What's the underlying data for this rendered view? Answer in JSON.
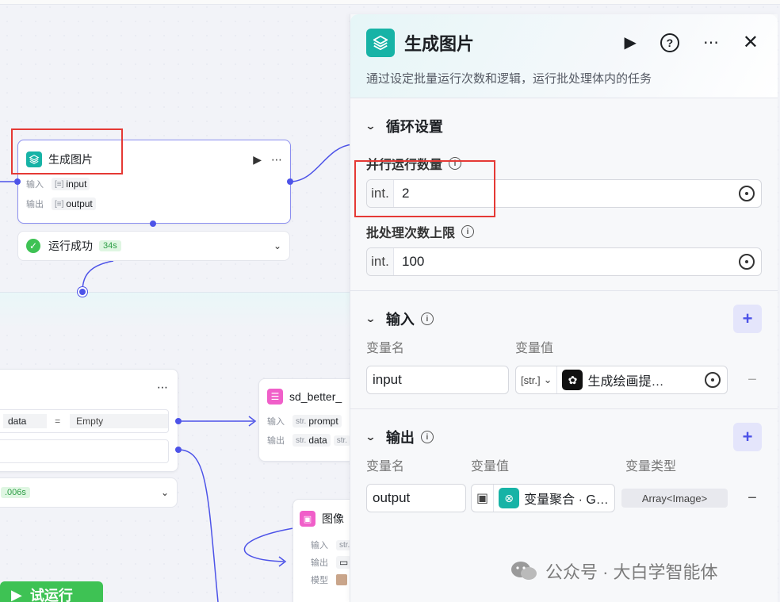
{
  "canvas": {
    "node_main": {
      "title": "生成图片",
      "input_label": "输入",
      "input_value": "input",
      "output_label": "输出",
      "output_value": "output"
    },
    "status": {
      "text": "运行成功",
      "time": "34s"
    },
    "node_cond": {
      "left_value": "data",
      "op": "=",
      "right_value": "Empty",
      "time": ".006s"
    },
    "node_sd": {
      "title": "sd_better_",
      "input_label": "输入",
      "input_type": "str.",
      "input_value": "prompt",
      "output_label": "输出",
      "output_type": "str.",
      "output_value": "data",
      "output_type2": "str."
    },
    "node_img": {
      "title": "图像",
      "input_label": "输入",
      "input_type": "str.",
      "output_label": "输出",
      "model_label": "模型"
    },
    "run_button": "试运行"
  },
  "panel": {
    "title": "生成图片",
    "description": "通过设定批量运行次数和逻辑，运行批处理体内的任务",
    "loop": {
      "heading": "循环设置",
      "concurrency_label": "并行运行数量",
      "concurrency_type": "int.",
      "concurrency_value": "2",
      "max_label": "批处理次数上限",
      "max_type": "int.",
      "max_value": "100"
    },
    "input": {
      "heading": "输入",
      "col_name": "变量名",
      "col_value": "变量值",
      "rows": [
        {
          "name": "input",
          "type": "[str.]",
          "ref": "生成绘画提…"
        }
      ]
    },
    "output": {
      "heading": "输出",
      "col_name": "变量名",
      "col_value": "变量值",
      "col_type": "变量类型",
      "rows": [
        {
          "name": "output",
          "ref": "变量聚合 · G…",
          "type": "Array<Image>"
        }
      ]
    }
  },
  "watermark": "公众号 · 大白学智能体",
  "colors": {
    "accent": "#4d53e8",
    "brand_teal": "#17b3a6",
    "success": "#3ec254",
    "highlight": "#e53935"
  }
}
